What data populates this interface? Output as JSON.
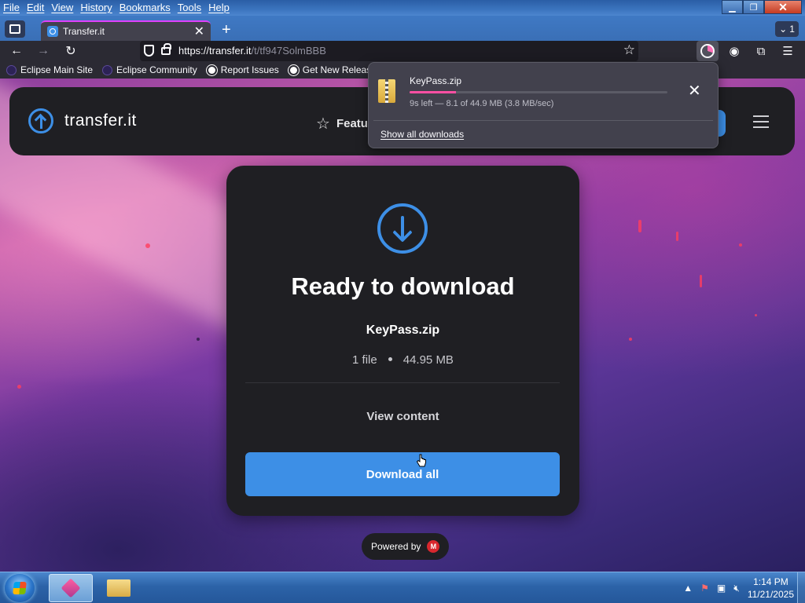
{
  "menubar": {
    "items": [
      "File",
      "Edit",
      "View",
      "History",
      "Bookmarks",
      "Tools",
      "Help"
    ]
  },
  "window_controls": {
    "minimize": "▁",
    "maximize": "❐",
    "close": "✕"
  },
  "tabs": {
    "active_title": "Transfer.it",
    "close_glyph": "✕",
    "new_tab_glyph": "+",
    "list_all_count": "1"
  },
  "navbar": {
    "url_host": "https://transfer.it",
    "url_path": "/t/tf947SolmBBB",
    "back_glyph": "←",
    "forward_glyph": "→",
    "reload_glyph": "↻",
    "star_glyph": "☆"
  },
  "toolbar_icons": [
    "downloads-icon",
    "account-icon",
    "extensions-icon",
    "menu-icon"
  ],
  "bookmarks": [
    {
      "label": "Eclipse Main Site",
      "icon": "eclipse-icon"
    },
    {
      "label": "Eclipse Community",
      "icon": "eclipse-icon"
    },
    {
      "label": "Report Issues",
      "icon": "github-icon"
    },
    {
      "label": "Get New Releases",
      "icon": "github-icon"
    }
  ],
  "site_header": {
    "logo_text": "transfer.it",
    "features_label": "Featu"
  },
  "card": {
    "heading": "Ready to download",
    "file_name": "KeyPass.zip",
    "file_count": "1 file",
    "file_size": "44.95 MB",
    "view_content": "View content",
    "download_all": "Download all"
  },
  "powered_by": {
    "label": "Powered by",
    "logo_letter": "M"
  },
  "downloads_panel": {
    "file_name": "KeyPass.zip",
    "progress_fraction": 0.18,
    "status": "9s left — 8.1 of 44.9 MB (3.8 MB/sec)",
    "show_all": "Show all downloads",
    "close_glyph": "✕"
  },
  "taskbar": {
    "time": "1:14 PM",
    "date": "11/21/2025",
    "tray_up_glyph": "▲"
  },
  "colors": {
    "accent": "#3d8fe6",
    "progress": "#ff4fa3",
    "card_bg": "#1f1f23"
  }
}
